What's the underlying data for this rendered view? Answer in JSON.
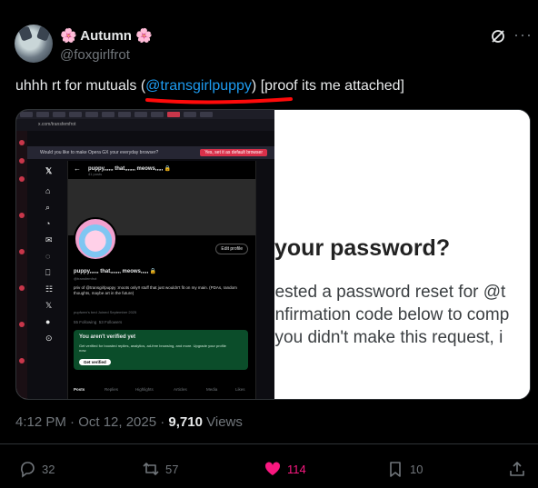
{
  "author": {
    "display_name": "🌸 Autumn 🌸",
    "handle": "@foxgirlfrot"
  },
  "tweet": {
    "text_before": "uhhh rt for mutuals (",
    "mention": "@transgirlpuppy",
    "text_after": ") [proof its me attached]"
  },
  "media": {
    "left_screenshot": {
      "url": "x.com/transfemfrot",
      "opera_prompt": "Would you like to make Opera GX your everyday browser?",
      "opera_button": "Yes, set it as default browser",
      "profile_title": "puppy,,,,,, that,,,,,,, meows,,,,, 🔒",
      "profile_posts": "41 posts",
      "edit_profile": "Edit profile",
      "profile_name": "puppy,,,,,, that,,,,,,, meows,,,,, 🔒",
      "profile_handle": "@transfemfrot",
      "bio": "priv of @transgirlpuppy :moots only!! stuff that just wouldn't fit on my main. (PDAs, random thoughts, maybe art in the future)",
      "meta": "pupfwen's bed   Joined September 2025",
      "following": "55 Following",
      "followers": "53 Followers",
      "verify_heading": "You aren't verified yet",
      "verify_body": "Get verified for boosted replies, analytics, ad-free browsing, and more. Upgrade your profile now.",
      "verify_button": "Get verified",
      "tabs": [
        "Posts",
        "Replies",
        "Highlights",
        "Articles",
        "Media",
        "Likes"
      ]
    },
    "right_screenshot": {
      "title": "your password?",
      "line1": "uested a password reset for @t",
      "line2": "onfirmation code below to comp",
      "line3": "f you didn't make this request, i"
    }
  },
  "meta": {
    "time": "4:12 PM · Oct 12, 2025 · ",
    "views_count": "9,710",
    "views_label": " Views"
  },
  "actions": {
    "replies": "32",
    "reposts": "57",
    "likes": "114",
    "bookmarks": "10"
  },
  "colors": {
    "background": "#000000",
    "accent": "#1d9bf0",
    "like": "#f91880",
    "muted": "#71767b"
  }
}
